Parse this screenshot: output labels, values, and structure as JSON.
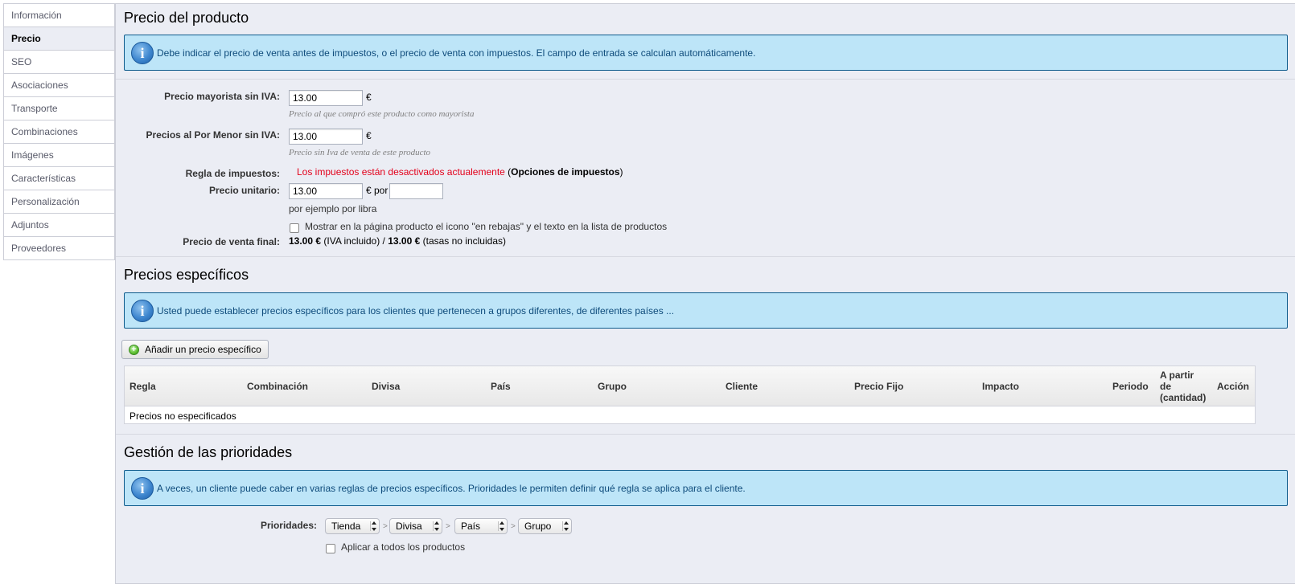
{
  "sidebar": {
    "items": [
      {
        "label": "Información"
      },
      {
        "label": "Precio"
      },
      {
        "label": "SEO"
      },
      {
        "label": "Asociaciones"
      },
      {
        "label": "Transporte"
      },
      {
        "label": "Combinaciones"
      },
      {
        "label": "Imágenes"
      },
      {
        "label": "Características"
      },
      {
        "label": "Personalización"
      },
      {
        "label": "Adjuntos"
      },
      {
        "label": "Proveedores"
      }
    ],
    "active": "Precio"
  },
  "price_section": {
    "title": "Precio del producto",
    "hint": "Debe indicar el precio de venta antes de impuestos, o el precio de venta con impuestos. El campo de entrada se calculan automáticamente.",
    "wholesale": {
      "label": "Precio mayorista sin IVA:",
      "value": "13.00",
      "currency": "€",
      "help": "Precio al que compró este producto como mayorista"
    },
    "retail": {
      "label": "Precios al Por Menor sin IVA:",
      "value": "13.00",
      "currency": "€",
      "help": "Precio sin Iva de venta de este producto"
    },
    "tax_rule": {
      "label": "Regla de impuestos:",
      "warning": "Los impuestos están desactivados actualemente",
      "open_paren": "(",
      "link": "Opciones de impuestos",
      "close_paren": ")"
    },
    "unit_price": {
      "label": "Precio unitario:",
      "value": "13.00",
      "currency_per": "€ por",
      "unit_value": "",
      "example": "por ejemplo por libra"
    },
    "on_sale": {
      "label": "Mostrar en la página producto el icono \"en rebajas\" y el texto en la lista de productos",
      "checked": false
    },
    "final_price": {
      "label": "Precio de venta final:",
      "with_tax": "13.00 €",
      "with_tax_note": "(IVA incluido) /",
      "without_tax": "13.00 €",
      "without_tax_note": "(tasas no incluidas)"
    }
  },
  "specific_section": {
    "title": "Precios específicos",
    "hint": "Usted puede establecer precios específicos para los clientes que pertenecen a grupos diferentes, de diferentes países ...",
    "add_button": "Añadir un precio específico",
    "table": {
      "headers": [
        "Regla",
        "Combinación",
        "Divisa",
        "País",
        "Grupo",
        "Cliente",
        "Precio Fijo",
        "Impacto",
        "Periodo",
        "A partir\nde\n(cantidad)",
        "Acción"
      ],
      "header_quantity_lines": [
        "A partir",
        "de",
        "(cantidad)"
      ],
      "empty_text": "Precios no especificados"
    }
  },
  "priority_section": {
    "title": "Gestión de las prioridades",
    "hint": "A veces, un cliente puede caber en varias reglas de precios específicos. Prioridades le permiten definir qué regla se aplica para el cliente.",
    "label": "Prioridades:",
    "selects": [
      "Tienda",
      "Divisa",
      "País",
      "Grupo"
    ],
    "separator": ">",
    "apply_all": {
      "label": "Aplicar a todos los productos",
      "checked": false
    }
  },
  "icons": {
    "info": "info-icon",
    "add": "add-circle-icon"
  },
  "colors": {
    "hint_bg": "#bde5f8",
    "hint_border": "#0e5b8c",
    "warning_text": "#e3001b",
    "panel_bg": "#ebedf4"
  }
}
